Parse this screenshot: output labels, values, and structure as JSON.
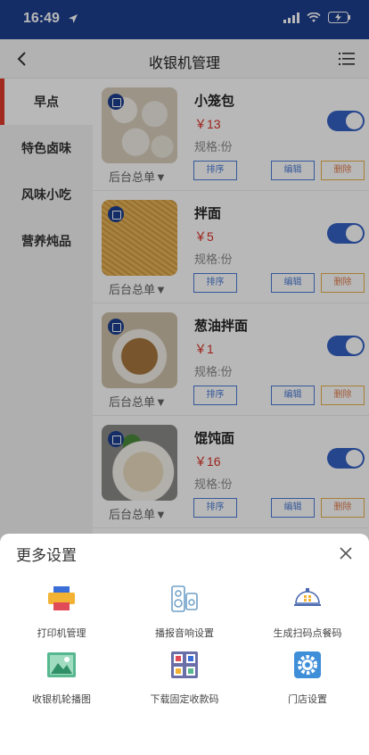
{
  "status_bar": {
    "time": "16:49",
    "location_arrow": "location-arrow-icon"
  },
  "navbar": {
    "title": "收银机管理"
  },
  "sidebar": {
    "items": [
      {
        "label": "早点",
        "active": true
      },
      {
        "label": "特色卤味",
        "active": false
      },
      {
        "label": "风味小吃",
        "active": false
      },
      {
        "label": "营养炖品",
        "active": false
      }
    ]
  },
  "products": [
    {
      "name": "小笼包",
      "price": "￥13",
      "spec": "规格:份",
      "order": "后台总单▼",
      "sort": "排序",
      "edit": "编辑",
      "delete": "删除",
      "enabled": true
    },
    {
      "name": "拌面",
      "price": "￥5",
      "spec": "规格:份",
      "order": "后台总单▼",
      "sort": "排序",
      "edit": "编辑",
      "delete": "删除",
      "enabled": true
    },
    {
      "name": "葱油拌面",
      "price": "￥1",
      "spec": "规格:份",
      "order": "后台总单▼",
      "sort": "排序",
      "edit": "编辑",
      "delete": "删除",
      "enabled": true
    },
    {
      "name": "馄饨面",
      "price": "￥16",
      "spec": "规格:份",
      "order": "后台总单▼",
      "sort": "排序",
      "edit": "编辑",
      "delete": "删除",
      "enabled": true
    }
  ],
  "sheet": {
    "title": "更多设置",
    "options": [
      {
        "label": "打印机管理",
        "icon": "printer-icon"
      },
      {
        "label": "播报音响设置",
        "icon": "speaker-icon"
      },
      {
        "label": "生成扫码点餐码",
        "icon": "scan-order-icon"
      },
      {
        "label": "收银机轮播图",
        "icon": "carousel-image-icon"
      },
      {
        "label": "下载固定收款码",
        "icon": "qr-code-icon"
      },
      {
        "label": "门店设置",
        "icon": "gear-icon"
      }
    ]
  },
  "colors": {
    "nav": "#1d3f8f",
    "accent": "#3460c4",
    "price": "#d93025",
    "active_bar": "#e03a2a"
  }
}
